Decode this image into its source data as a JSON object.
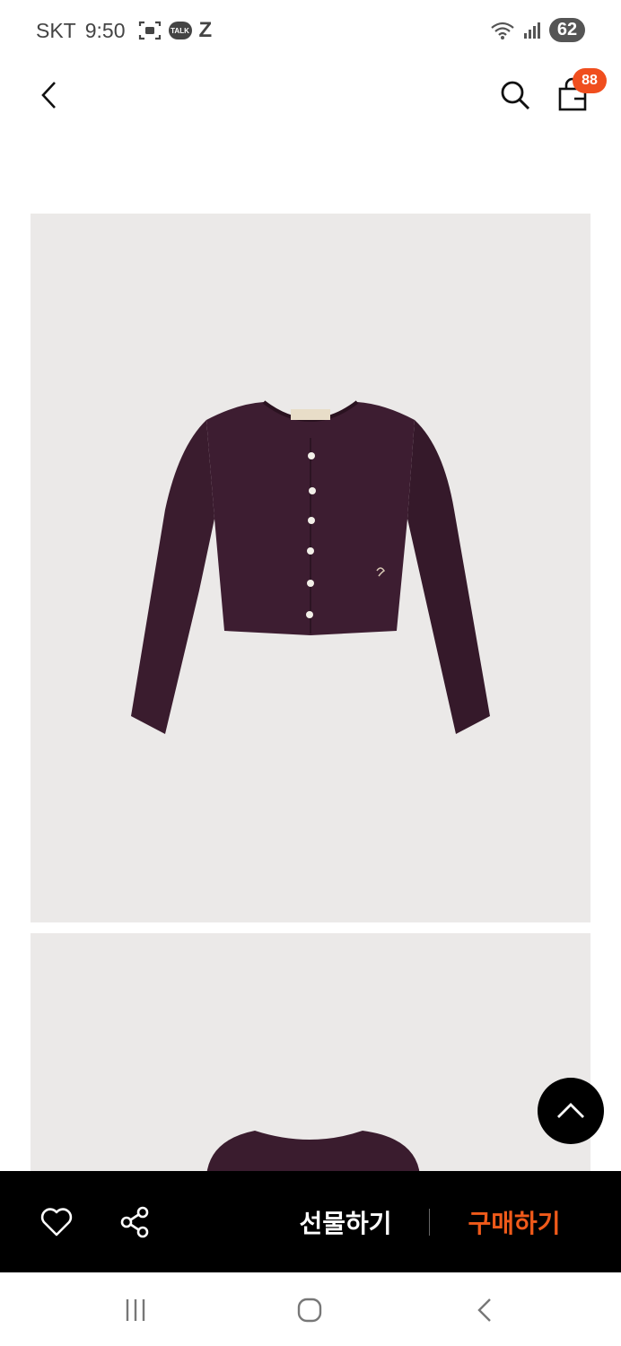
{
  "status_bar": {
    "carrier": "SKT",
    "time": "9:50",
    "talk_label": "TALK",
    "z_label": "Z",
    "battery": "62",
    "icons": [
      "screenshot-icon",
      "kakaotalk-icon",
      "z-app-icon",
      "wifi-icon",
      "signal-icon",
      "battery-icon"
    ]
  },
  "header": {
    "cart_count": "88",
    "icons": [
      "back-arrow-icon",
      "search-icon",
      "shopping-bag-icon"
    ]
  },
  "product": {
    "images": [
      "cardigan-front-image",
      "cardigan-back-image"
    ],
    "garment_color": "#3a1c2e",
    "background_color": "#ebe9e8"
  },
  "action_bar": {
    "gift_label": "선물하기",
    "buy_label": "구매하기",
    "buy_color": "#f05a1a",
    "icons": [
      "heart-icon",
      "share-icon"
    ]
  },
  "nav_bar": {
    "icons": [
      "recent-apps-icon",
      "home-icon",
      "back-icon"
    ]
  },
  "colors": {
    "badge": "#f04e1e",
    "action_bar_bg": "#000000"
  }
}
